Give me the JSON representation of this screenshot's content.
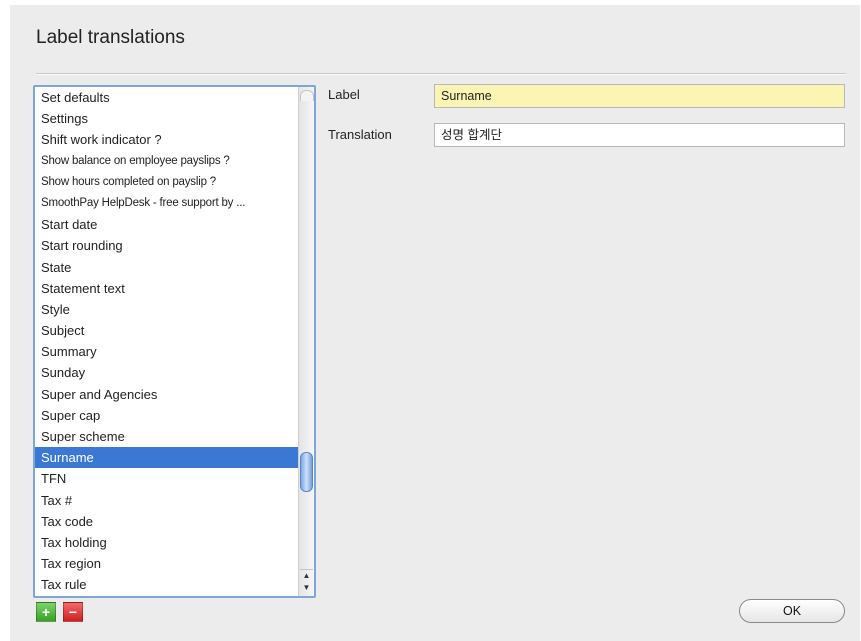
{
  "window": {
    "title": "Label translations"
  },
  "list": {
    "items": [
      {
        "label": "Set defaults",
        "small": false,
        "selected": false
      },
      {
        "label": "Settings",
        "small": false,
        "selected": false
      },
      {
        "label": "Shift work indicator ?",
        "small": false,
        "selected": false
      },
      {
        "label": "Show balance on employee payslips ?",
        "small": true,
        "selected": false
      },
      {
        "label": "Show hours completed on payslip ?",
        "small": true,
        "selected": false
      },
      {
        "label": "SmoothPay HelpDesk - free support by ...",
        "small": true,
        "selected": false
      },
      {
        "label": "Start date",
        "small": false,
        "selected": false
      },
      {
        "label": "Start rounding",
        "small": false,
        "selected": false
      },
      {
        "label": "State",
        "small": false,
        "selected": false
      },
      {
        "label": "Statement text",
        "small": false,
        "selected": false
      },
      {
        "label": "Style",
        "small": false,
        "selected": false
      },
      {
        "label": "Subject",
        "small": false,
        "selected": false
      },
      {
        "label": "Summary",
        "small": false,
        "selected": false
      },
      {
        "label": "Sunday",
        "small": false,
        "selected": false
      },
      {
        "label": "Super and Agencies",
        "small": false,
        "selected": false
      },
      {
        "label": "Super cap",
        "small": false,
        "selected": false
      },
      {
        "label": "Super scheme",
        "small": false,
        "selected": false
      },
      {
        "label": "Surname",
        "small": false,
        "selected": true
      },
      {
        "label": "TFN",
        "small": false,
        "selected": false
      },
      {
        "label": "Tax #",
        "small": false,
        "selected": false
      },
      {
        "label": "Tax code",
        "small": false,
        "selected": false
      },
      {
        "label": "Tax holding",
        "small": false,
        "selected": false
      },
      {
        "label": "Tax region",
        "small": false,
        "selected": false
      },
      {
        "label": "Tax rule",
        "small": false,
        "selected": false
      }
    ]
  },
  "form": {
    "label_caption": "Label",
    "label_value": "Surname",
    "translation_caption": "Translation",
    "translation_value": "성명 합계단"
  },
  "buttons": {
    "add_symbol": "+",
    "remove_symbol": "−",
    "ok_label": "OK",
    "scroll_up_symbol": "▲",
    "scroll_down_symbol": "▼"
  },
  "colors": {
    "selection": "#3a78d4",
    "label_field_bg": "#fbf5b4",
    "add_button": "#3aa028",
    "remove_button": "#cf2020"
  }
}
